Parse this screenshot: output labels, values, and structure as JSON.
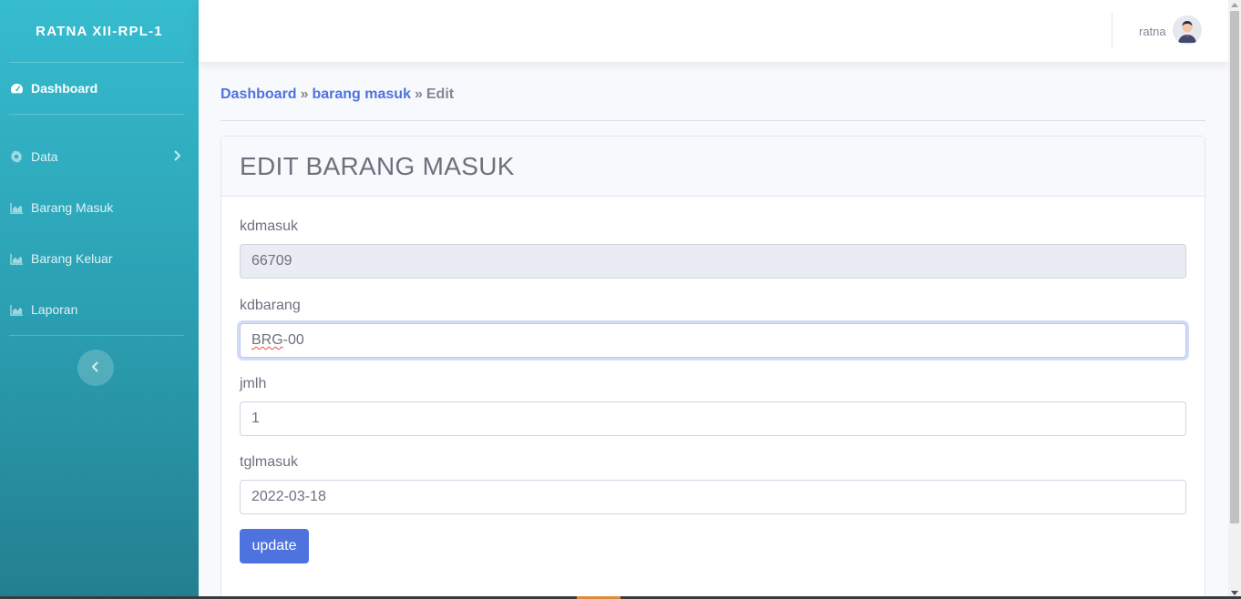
{
  "sidebar": {
    "brand": "RATNA XII-RPL-1",
    "items": [
      {
        "label": "Dashboard",
        "icon": "tachometer-icon",
        "active": true
      },
      {
        "label": "Data",
        "icon": "gear-icon"
      },
      {
        "label": "Barang Masuk",
        "icon": "chart-area-icon"
      },
      {
        "label": "Barang Keluar",
        "icon": "chart-area-icon"
      },
      {
        "label": "Laporan",
        "icon": "chart-area-icon"
      }
    ],
    "toggle_icon": "chevron-left-icon"
  },
  "topbar": {
    "username": "ratna",
    "avatar_icon": "user-avatar-icon"
  },
  "breadcrumb": {
    "items": [
      "Dashboard",
      "barang masuk",
      "Edit"
    ],
    "separator": "»"
  },
  "card": {
    "title": "EDIT BARANG MASUK"
  },
  "form": {
    "fields": [
      {
        "label": "kdmasuk",
        "value": "66709",
        "readonly": true
      },
      {
        "label": "kdbarang",
        "value_prefix": "BRG",
        "value_suffix": "-00",
        "value": "BRG-00",
        "focused": true
      },
      {
        "label": "jmlh",
        "value": "1"
      },
      {
        "label": "tglmasuk",
        "value": "2022-03-18"
      }
    ],
    "submit_label": "update"
  },
  "colors": {
    "primary": "#4e73df",
    "sidebar_top": "#36bccf",
    "sidebar_bottom": "#237f8f",
    "text_muted": "#6e707e"
  }
}
